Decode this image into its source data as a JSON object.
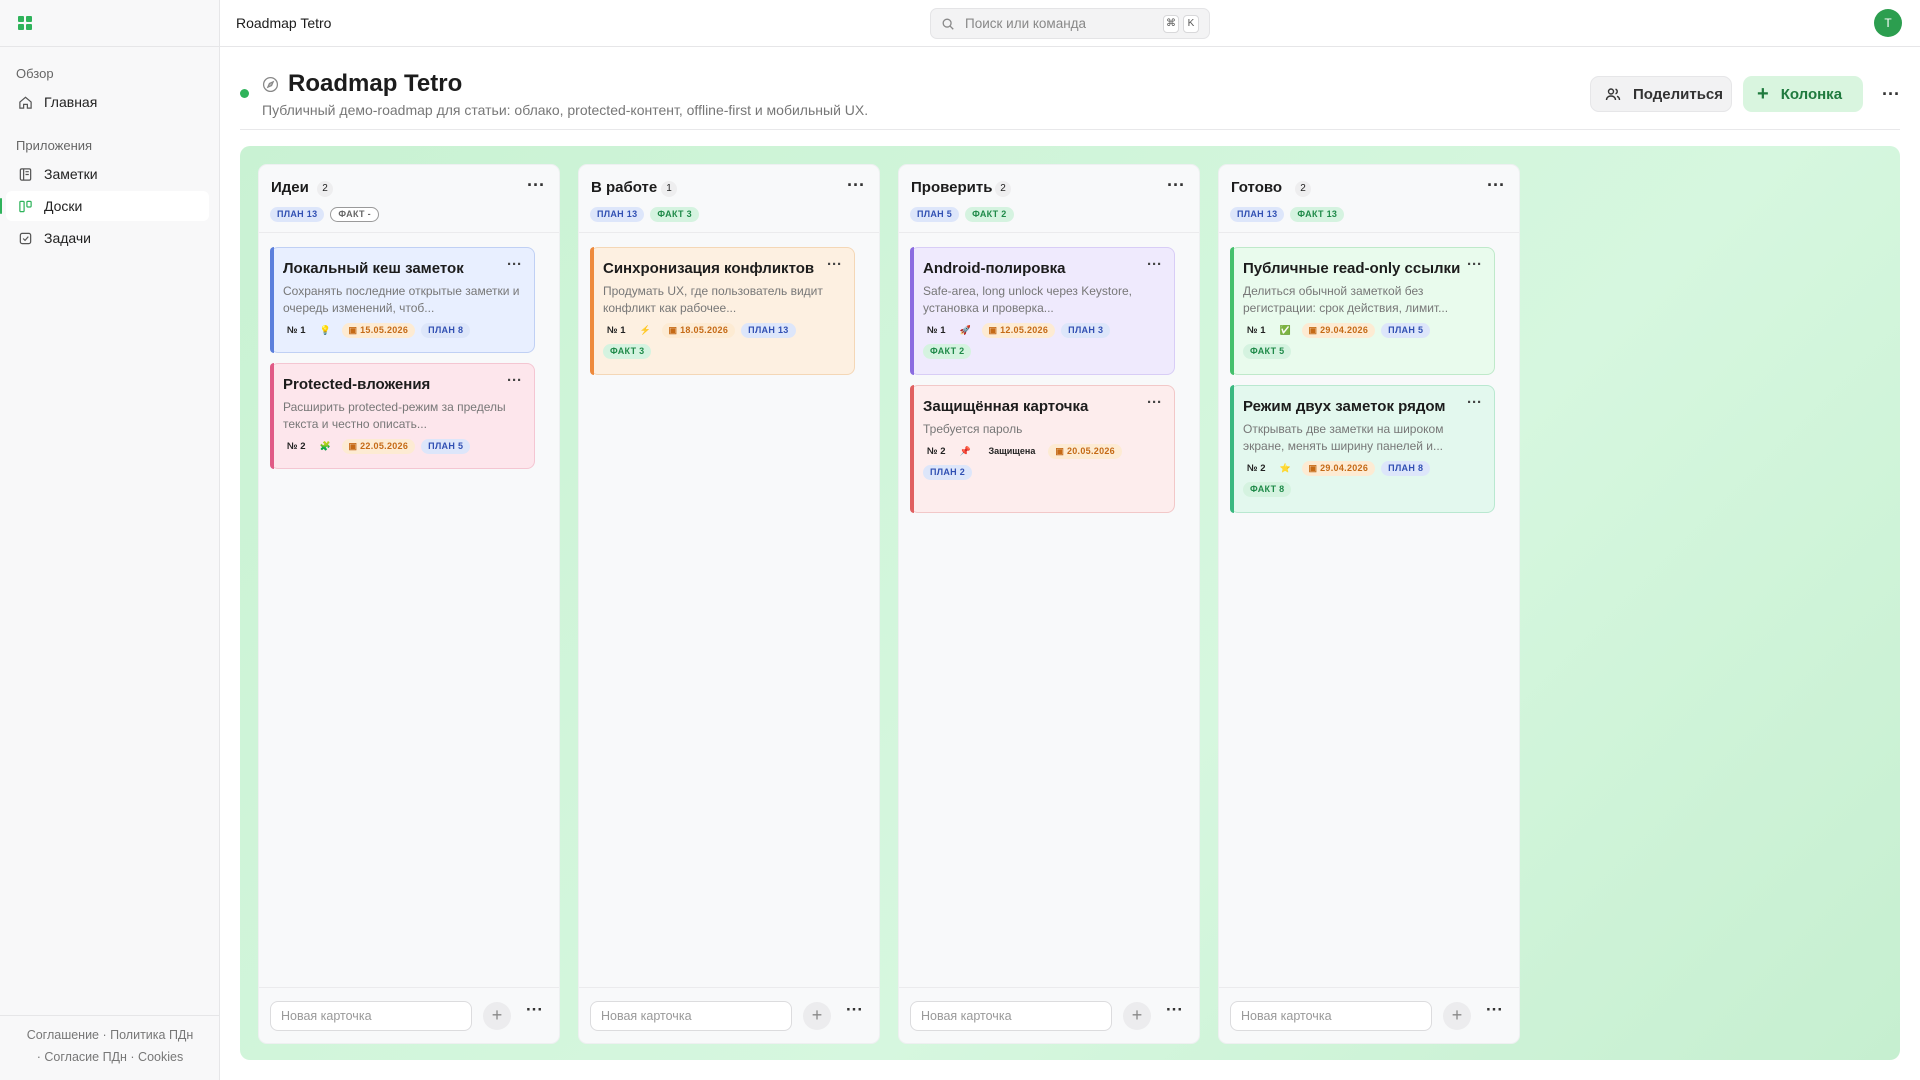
{
  "sidebar": {
    "section_overview": "Обзор",
    "home": "Главная",
    "section_apps": "Приложения",
    "notes": "Заметки",
    "boards": "Доски",
    "tasks": "Задачи",
    "footer": {
      "agreement": "Соглашение",
      "policy": "Политика ПДн",
      "consent": "Согласие ПДн",
      "cookies": "Cookies"
    }
  },
  "topbar": {
    "title": "Roadmap Tetro",
    "search_placeholder": "Поиск или команда",
    "kbd_cmd": "⌘",
    "kbd_k": "K",
    "avatar": "T"
  },
  "board": {
    "title": "Roadmap Tetro",
    "description": "Публичный демо-roadmap для статьи: облако, protected-контент, offline-first и мобильный UX.",
    "share_label": "Поделиться",
    "add_column_label": "Колонка",
    "accent": "#2fb35b",
    "columns": [
      {
        "title": "Идеи",
        "count": "2",
        "plan": "ПЛАН 13",
        "fact": "ФАКТ -",
        "new_card_placeholder": "Новая карточка",
        "cards": [
          {
            "title": "Локальный кеш заметок",
            "desc": "Сохранять последние открытые заметки и очередь изменений, чтоб...",
            "num": "№ 1",
            "emoji": "💡",
            "date": "15.05.2026",
            "plan": "ПЛАН 8"
          },
          {
            "title": "Protected-вложения",
            "desc": "Расширить protected-режим за пределы текста и честно описать...",
            "num": "№ 2",
            "emoji": "🧩",
            "date": "22.05.2026",
            "plan": "ПЛАН 5"
          }
        ]
      },
      {
        "title": "В работе",
        "count": "1",
        "plan": "ПЛАН 13",
        "fact": "ФАКТ 3",
        "new_card_placeholder": "Новая карточка",
        "cards": [
          {
            "title": "Синхронизация конфликтов",
            "desc": "Продумать UX, где пользователь видит конфликт как рабочее...",
            "num": "№ 1",
            "emoji": "⚡",
            "date": "18.05.2026",
            "plan": "ПЛАН 13",
            "fact": "ФАКТ 3"
          }
        ]
      },
      {
        "title": "Проверить",
        "count": "2",
        "plan": "ПЛАН 5",
        "fact": "ФАКТ 2",
        "new_card_placeholder": "Новая карточка",
        "cards": [
          {
            "title": "Android-полировка",
            "desc": "Safe-area, long unlock через Keystore, установка и проверка...",
            "num": "№ 1",
            "emoji": "🚀",
            "date": "12.05.2026",
            "plan": "ПЛАН 3",
            "fact": "ФАКТ 2"
          },
          {
            "title": "Защищённая карточка",
            "desc": "Требуется пароль",
            "num": "№ 2",
            "emoji": "📌",
            "protected": "Защищена",
            "date": "20.05.2026",
            "plan": "ПЛАН 2"
          }
        ]
      },
      {
        "title": "Готово",
        "count": "2",
        "plan": "ПЛАН 13",
        "fact": "ФАКТ 13",
        "new_card_placeholder": "Новая карточка",
        "cards": [
          {
            "title": "Публичные read-only ссылки",
            "desc": "Делиться обычной заметкой без регистрации: срок действия, лимит...",
            "num": "№ 1",
            "emoji": "✅",
            "date": "29.04.2026",
            "plan": "ПЛАН 5",
            "fact": "ФАКТ 5"
          },
          {
            "title": "Режим двух заметок рядом",
            "desc": "Открывать две заметки на широком экране, менять ширину панелей и...",
            "num": "№ 2",
            "emoji": "⭐",
            "date": "29.04.2026",
            "plan": "ПЛАН 8",
            "fact": "ФАКТ 8"
          }
        ]
      }
    ]
  }
}
